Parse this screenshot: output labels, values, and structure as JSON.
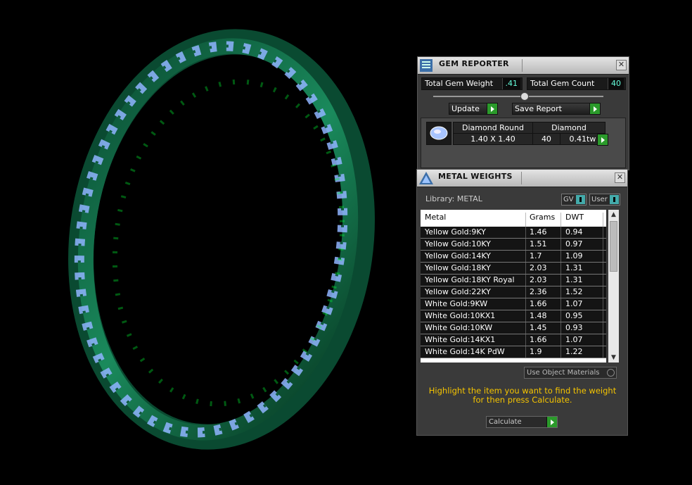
{
  "gem_reporter": {
    "title": "GEM REPORTER",
    "close": "✕",
    "total_gem_weight_label": "Total Gem Weight",
    "total_gem_weight_value": ".41",
    "total_gem_count_label": "Total Gem Count",
    "total_gem_count_value": "40",
    "update_label": "Update",
    "save_report_label": "Save Report",
    "gem": {
      "shape": "Diamond Round",
      "type": "Diamond",
      "size": "1.40 X 1.40",
      "count": "40",
      "weight": "0.41tw"
    }
  },
  "metal_weights": {
    "title": "METAL WEIGHTS",
    "close": "✕",
    "library_label": "Library: METAL",
    "gv_label": "GV",
    "user_label": "User",
    "columns": [
      "Metal",
      "Grams",
      "DWT"
    ],
    "rows": [
      {
        "metal": "Yellow Gold:9KY",
        "grams": "1.46",
        "dwt": "0.94"
      },
      {
        "metal": "Yellow Gold:10KY",
        "grams": "1.51",
        "dwt": "0.97"
      },
      {
        "metal": "Yellow Gold:14KY",
        "grams": "1.7",
        "dwt": "1.09"
      },
      {
        "metal": "Yellow Gold:18KY",
        "grams": "2.03",
        "dwt": "1.31"
      },
      {
        "metal": "Yellow Gold:18KY Royal",
        "grams": "2.03",
        "dwt": "1.31"
      },
      {
        "metal": "Yellow Gold:22KY",
        "grams": "2.36",
        "dwt": "1.52"
      },
      {
        "metal": "White Gold:9KW",
        "grams": "1.66",
        "dwt": "1.07"
      },
      {
        "metal": "White Gold:10KX1",
        "grams": "1.48",
        "dwt": "0.95"
      },
      {
        "metal": "White Gold:10KW",
        "grams": "1.45",
        "dwt": "0.93"
      },
      {
        "metal": "White Gold:14KX1",
        "grams": "1.66",
        "dwt": "1.07"
      },
      {
        "metal": "White Gold:14K PdW",
        "grams": "1.9",
        "dwt": "1.22"
      }
    ],
    "use_object_materials_label": "Use Object Materials",
    "note": "Highlight the item you want to find the weight for then press Calculate.",
    "calculate_label": "Calculate"
  },
  "colors": {
    "metal_green": "#0d6b45",
    "gem_blue": "#8fb4ff",
    "note_yellow": "#f5c400",
    "accent_green": "#2b9a2b"
  }
}
